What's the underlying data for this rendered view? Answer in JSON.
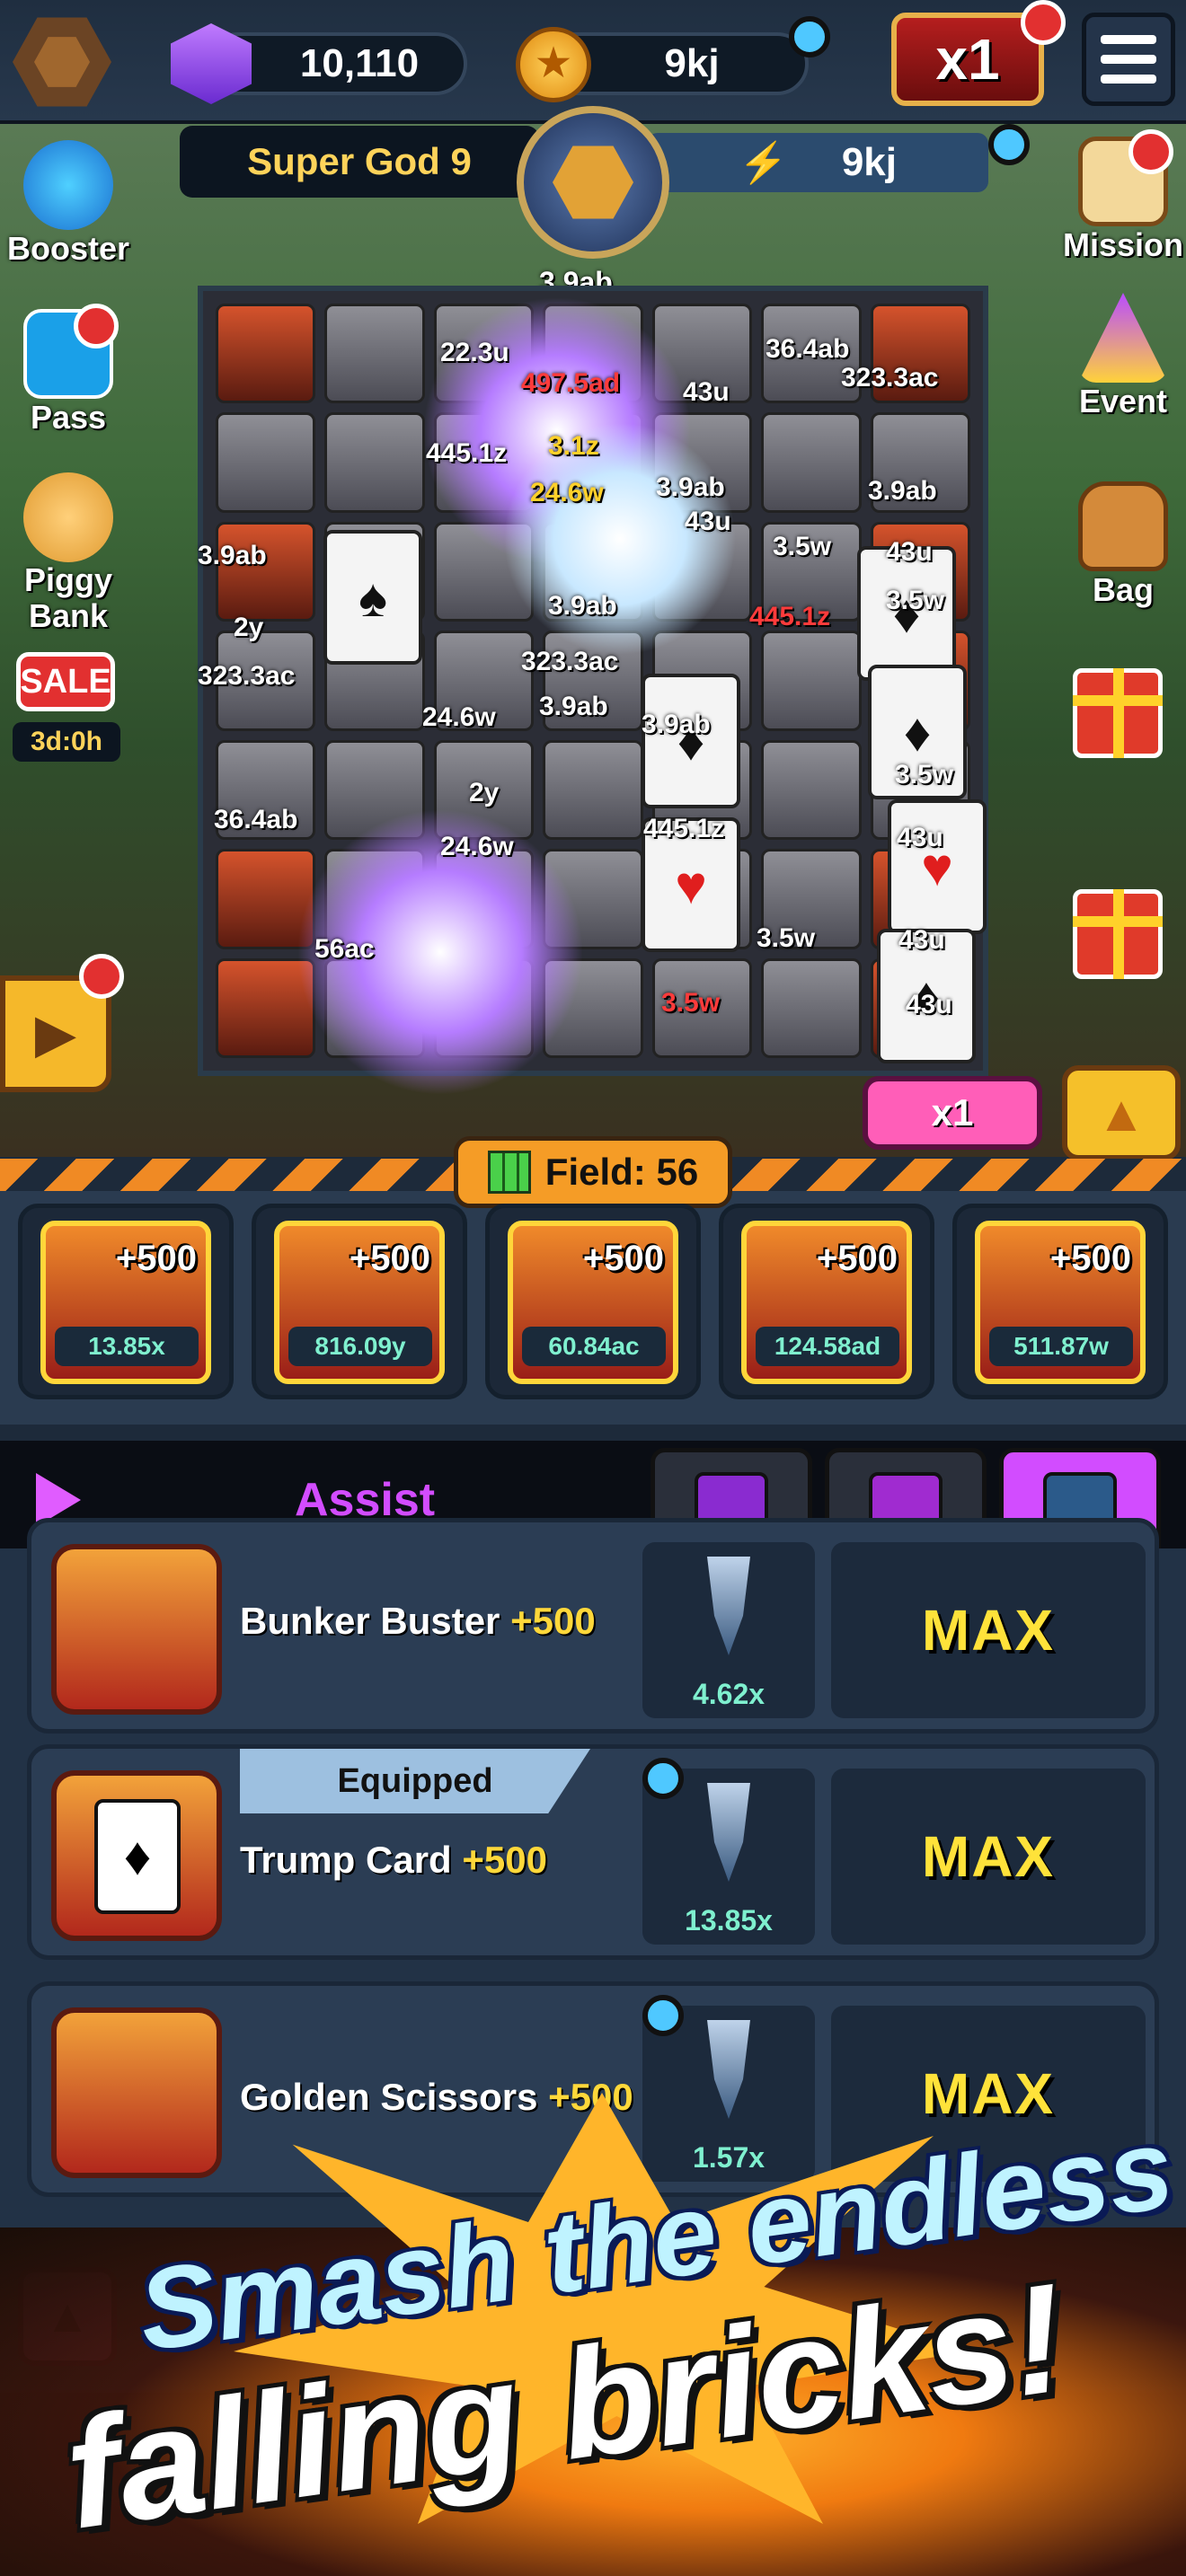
{
  "top": {
    "gems": "10,110",
    "coins": "9kj",
    "multiplier": "x1"
  },
  "stage": {
    "name": "Super God 9",
    "power": "9kj",
    "boss_hp": "3.9ab"
  },
  "left_menu": [
    {
      "label": "Booster",
      "icon": "lightning-globe-icon"
    },
    {
      "label": "Pass",
      "icon": "star-ticket-icon"
    },
    {
      "label": "Piggy Bank",
      "icon": "piggy-bank-icon"
    },
    {
      "label": "SALE",
      "icon": "sale-tag-icon"
    }
  ],
  "sale_timer": "3d:0h",
  "right_menu": [
    {
      "label": "Mission",
      "icon": "scroll-icon"
    },
    {
      "label": "Event",
      "icon": "party-hat-icon"
    },
    {
      "label": "Bag",
      "icon": "backpack-icon"
    }
  ],
  "damage_numbers": [
    "3.9ab",
    "497.5ad",
    "22.3u",
    "36.4ab",
    "323.3ac",
    "445.1z",
    "3.1z",
    "24.6w",
    "43u",
    "3.9ab",
    "43u",
    "3.5w",
    "3.9ab",
    "43u",
    "3.9ab",
    "2y",
    "323.3ac",
    "3.9ab",
    "445.1z",
    "3.5w",
    "323.3ac",
    "24.6w",
    "3.9ab",
    "3.5w",
    "3.9ab",
    "36.4ab",
    "2y",
    "24.6w",
    "445.1z",
    "43u",
    "3.5w",
    "43u",
    "56ac",
    "3.5w",
    "43u"
  ],
  "speed_button": "x1",
  "field": {
    "label": "Field: 56"
  },
  "slots": [
    {
      "plus": "+500",
      "value": "13.85x",
      "icon": "trump-card-icon"
    },
    {
      "plus": "+500",
      "value": "816.09y",
      "icon": "tornado-icon"
    },
    {
      "plus": "+500",
      "value": "60.84ac",
      "icon": "prism-icon"
    },
    {
      "plus": "+500",
      "value": "124.58ad",
      "icon": "scissors-icon"
    },
    {
      "plus": "+500",
      "value": "511.87w",
      "icon": "fidget-spinner-icon"
    }
  ],
  "assist": {
    "title": "Assist"
  },
  "weapons": [
    {
      "name": "Bunker Buster",
      "plus": "+500",
      "drill": "4.62x",
      "level": "MAX"
    },
    {
      "name": "Trump Card",
      "plus": "+500",
      "drill": "13.85x",
      "level": "MAX",
      "badge": "Equipped"
    },
    {
      "name": "Golden Scissors",
      "plus": "+500",
      "drill": "1.57x",
      "level": "MAX"
    }
  ],
  "banner": {
    "line1": "Smash the endless",
    "line2": "falling bricks!"
  },
  "colors": {
    "accent_orange": "#f59c26",
    "max_yellow": "#ffe23a",
    "value_teal": "#7ff0cf",
    "assist_purple": "#d24cff",
    "alert_red": "#e23030"
  }
}
